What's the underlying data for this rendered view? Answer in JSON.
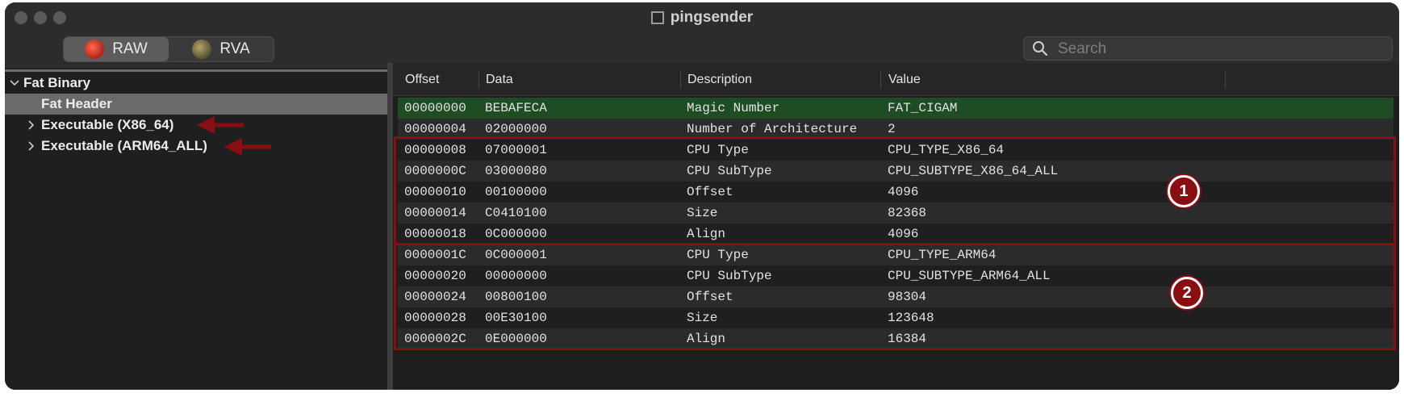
{
  "window": {
    "title": "pingsender",
    "document_icon": "document-icon"
  },
  "toolbar": {
    "segments": [
      {
        "label": "RAW",
        "icon": "raw-icon",
        "active": true
      },
      {
        "label": "RVA",
        "icon": "rva-icon",
        "active": false
      }
    ],
    "search": {
      "placeholder": "Search",
      "value": ""
    }
  },
  "sidebar": {
    "items": [
      {
        "label": "Fat Binary",
        "expanded": true,
        "level": 0
      },
      {
        "label": "Fat Header",
        "selected": true,
        "level": 1
      },
      {
        "label": "Executable  (X86_64)",
        "expanded": false,
        "level": 1
      },
      {
        "label": "Executable  (ARM64_ALL)",
        "expanded": false,
        "level": 1
      }
    ]
  },
  "table": {
    "columns": [
      "Offset",
      "Data",
      "Description",
      "Value"
    ],
    "rows": [
      {
        "offset": "00000000",
        "data": "BEBAFECA",
        "description": "Magic Number",
        "value": "FAT_CIGAM"
      },
      {
        "offset": "00000004",
        "data": "02000000",
        "description": "Number of Architecture",
        "value": "2"
      },
      {
        "offset": "00000008",
        "data": "07000001",
        "description": "CPU Type",
        "value": "CPU_TYPE_X86_64"
      },
      {
        "offset": "0000000C",
        "data": "03000080",
        "description": "CPU SubType",
        "value": "CPU_SUBTYPE_X86_64_ALL"
      },
      {
        "offset": "00000010",
        "data": "00100000",
        "description": "Offset",
        "value": "4096"
      },
      {
        "offset": "00000014",
        "data": "C0410100",
        "description": "Size",
        "value": "82368"
      },
      {
        "offset": "00000018",
        "data": "0C000000",
        "description": "Align",
        "value": "4096"
      },
      {
        "offset": "0000001C",
        "data": "0C000001",
        "description": "CPU Type",
        "value": "CPU_TYPE_ARM64"
      },
      {
        "offset": "00000020",
        "data": "00000000",
        "description": "CPU SubType",
        "value": "CPU_SUBTYPE_ARM64_ALL"
      },
      {
        "offset": "00000024",
        "data": "00800100",
        "description": "Offset",
        "value": "98304"
      },
      {
        "offset": "00000028",
        "data": "00E30100",
        "description": "Size",
        "value": "123648"
      },
      {
        "offset": "0000002C",
        "data": "0E000000",
        "description": "Align",
        "value": "16384"
      }
    ]
  },
  "annotations": {
    "badge_1": "1",
    "badge_2": "2"
  },
  "colors": {
    "annotation": "#8a0d12",
    "highlight_row": "#1f4d23",
    "selected_tree": "#6a6a6a"
  }
}
